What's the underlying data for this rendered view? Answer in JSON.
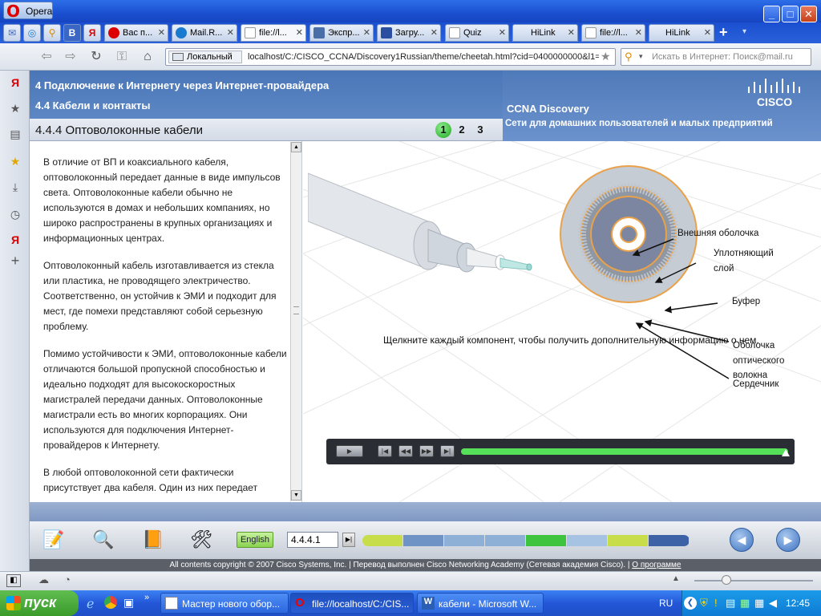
{
  "window": {
    "app_button": "Opera",
    "controls": {
      "minimize": "_",
      "maximize": "□",
      "close": "✕"
    }
  },
  "tabs": [
    {
      "label": "Вас п...",
      "active": false
    },
    {
      "label": "Mail.R...",
      "active": false
    },
    {
      "label": "file://l...",
      "active": true
    },
    {
      "label": "Экспр...",
      "active": false
    },
    {
      "label": "Загру...",
      "active": false
    },
    {
      "label": "Quiz",
      "active": false
    },
    {
      "label": "HiLink",
      "active": false
    },
    {
      "label": "file://l...",
      "active": false
    },
    {
      "label": "HiLink",
      "active": false
    }
  ],
  "address": {
    "zone": "Локальный",
    "url": "localhost/C:/CISCO_CCNA/Discovery1Russian/theme/cheetah.html?cid=0400000000&l1=t",
    "search_placeholder": "Искать в Интернет: Поиск@mail.ru"
  },
  "course": {
    "header_line1": "4 Подключение к Интернету через Интернет-провайдера",
    "header_line2": "4.4 Кабели и контакты",
    "brand": "CCNA Discovery",
    "brand_sub": "Сети для домашних пользователей и малых предприятий",
    "logo_text": "CISCO",
    "section_title": "4.4.4 Оптоволоконные кабели",
    "pages": [
      "1",
      "2",
      "3"
    ],
    "current_page": "1"
  },
  "text": {
    "p1": "В отличие от ВП и коаксиального кабеля, оптоволоконный передает данные в виде импульсов света. Оптоволоконные кабели обычно не используются в домах и небольших компаниях, но широко распространены в крупных организациях и информационных центрах.",
    "p2": "Оптоволоконный кабель изготавливается из стекла или пластика, не проводящего электричество. Соответственно, он устойчив к ЭМИ и подходит для мест, где помехи представляют собой серьезную проблему.",
    "p3": "Помимо устойчивости к ЭМИ, оптоволоконные кабели отличаются большой пропускной способностью и идеально подходят для высокоскоростных магистралей передачи данных. Оптоволоконные магистрали есть во многих корпорациях. Они используются для подключения Интернет-провайдеров к Интернету.",
    "p4": "В любой оптоволоконной сети фактически присутствует два кабеля. Один из них передает"
  },
  "diagram": {
    "labels": {
      "outer_jacket": "Внешняя оболочка",
      "strength_line1": "Уплотняющий",
      "strength_line2": "слой",
      "buffer": "Буфер",
      "cladding_line1": "Оболочка",
      "cladding_line2": "оптического",
      "cladding_line3": "волокна",
      "core": "Сердечник"
    },
    "instruction": "Щелкните каждый компонент, чтобы получить дополнительную информацию о нем."
  },
  "player": {
    "play": "▶",
    "first": "|◀",
    "rewind": "◀◀",
    "forward": "▶▶",
    "last": "▶|",
    "progress": 1.0
  },
  "toolbar": {
    "language": "English",
    "page_value": "4.4.4.1",
    "go": "▶|",
    "progress_colors": [
      "#c8dd4a",
      "#6f93c4",
      "#8fb0d6",
      "#8fb0d6",
      "#3ec43e",
      "#a7c3e3",
      "#c8dd4a",
      "#3d63a6"
    ],
    "prev": "◀",
    "next": "▶"
  },
  "copyright": {
    "text": "All contents copyright © 2007 Cisco Systems, Inc. | Перевод выполнен Cisco Networking Academy (Сетевая академия Cisco). | ",
    "link": "О программе"
  },
  "taskbar": {
    "start": "пуск",
    "tasks": [
      {
        "label": "Мастер нового обор..."
      },
      {
        "label": "file://localhost/C:/CIS..."
      },
      {
        "label": "кабели - Microsoft W..."
      }
    ],
    "language": "RU",
    "clock": "12:45"
  }
}
